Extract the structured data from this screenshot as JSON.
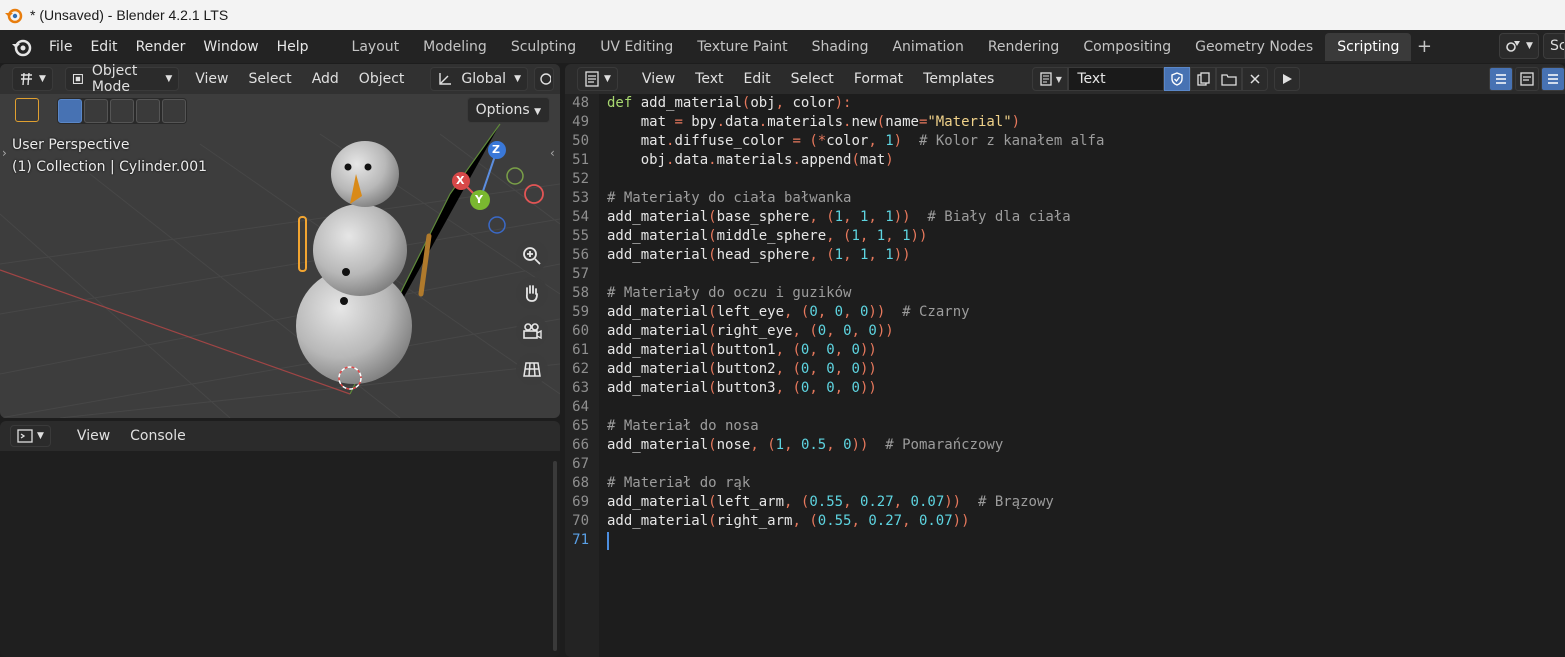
{
  "window": {
    "title": "* (Unsaved) - Blender 4.2.1 LTS"
  },
  "topbar": {
    "menus": [
      "File",
      "Edit",
      "Render",
      "Window",
      "Help"
    ],
    "workspaces": [
      "Layout",
      "Modeling",
      "Sculpting",
      "UV Editing",
      "Texture Paint",
      "Shading",
      "Animation",
      "Rendering",
      "Compositing",
      "Geometry Nodes",
      "Scripting"
    ],
    "active_workspace": "Scripting",
    "scene_label": "Sc"
  },
  "viewport": {
    "mode": "Object Mode",
    "menus": [
      "View",
      "Select",
      "Add",
      "Object"
    ],
    "transform": "Global",
    "options_label": "Options",
    "perspective": "User Perspective",
    "collection": "(1) Collection | Cylinder.001",
    "gizmo": {
      "z": "Z",
      "x": "X",
      "y": "Y"
    }
  },
  "console": {
    "menus": [
      "View",
      "Console"
    ]
  },
  "editor": {
    "menus": [
      "View",
      "Text",
      "Edit",
      "Select",
      "Format",
      "Templates"
    ],
    "text_name": "Text",
    "lines": [
      {
        "n": "48",
        "tokens": [
          [
            "kw",
            "def"
          ],
          [
            "p",
            " add_material"
          ],
          [
            "sym",
            "("
          ],
          [
            "p",
            "obj"
          ],
          [
            "sym",
            ","
          ],
          [
            "p",
            " color"
          ],
          [
            "sym",
            "):"
          ]
        ]
      },
      {
        "n": "49",
        "tokens": [
          [
            "p",
            "    mat "
          ],
          [
            "sym",
            "="
          ],
          [
            "p",
            " bpy"
          ],
          [
            "sym",
            "."
          ],
          [
            "p",
            "data"
          ],
          [
            "sym",
            "."
          ],
          [
            "p",
            "materials"
          ],
          [
            "sym",
            "."
          ],
          [
            "p",
            "new"
          ],
          [
            "sym",
            "("
          ],
          [
            "p",
            "name"
          ],
          [
            "sym",
            "="
          ],
          [
            "str",
            "\"Material\""
          ],
          [
            "sym",
            ")"
          ]
        ]
      },
      {
        "n": "50",
        "tokens": [
          [
            "p",
            "    mat"
          ],
          [
            "sym",
            "."
          ],
          [
            "p",
            "diffuse_color "
          ],
          [
            "sym",
            "="
          ],
          [
            "p",
            " "
          ],
          [
            "sym",
            "(*"
          ],
          [
            "p",
            "color"
          ],
          [
            "sym",
            ","
          ],
          [
            "p",
            " "
          ],
          [
            "num",
            "1"
          ],
          [
            "sym",
            ")"
          ],
          [
            "p",
            "  "
          ],
          [
            "cmt",
            "# Kolor z kanałem alfa"
          ]
        ]
      },
      {
        "n": "51",
        "tokens": [
          [
            "p",
            "    obj"
          ],
          [
            "sym",
            "."
          ],
          [
            "p",
            "data"
          ],
          [
            "sym",
            "."
          ],
          [
            "p",
            "materials"
          ],
          [
            "sym",
            "."
          ],
          [
            "p",
            "append"
          ],
          [
            "sym",
            "("
          ],
          [
            "p",
            "mat"
          ],
          [
            "sym",
            ")"
          ]
        ]
      },
      {
        "n": "52",
        "tokens": []
      },
      {
        "n": "53",
        "tokens": [
          [
            "cmt",
            "# Materiały do ciała bałwanka"
          ]
        ]
      },
      {
        "n": "54",
        "tokens": [
          [
            "p",
            "add_material"
          ],
          [
            "sym",
            "("
          ],
          [
            "p",
            "base_sphere"
          ],
          [
            "sym",
            ","
          ],
          [
            "p",
            " "
          ],
          [
            "sym",
            "("
          ],
          [
            "num",
            "1"
          ],
          [
            "sym",
            ","
          ],
          [
            "p",
            " "
          ],
          [
            "num",
            "1"
          ],
          [
            "sym",
            ","
          ],
          [
            "p",
            " "
          ],
          [
            "num",
            "1"
          ],
          [
            "sym",
            "))"
          ],
          [
            "p",
            "  "
          ],
          [
            "cmt",
            "# Biały dla ciała"
          ]
        ]
      },
      {
        "n": "55",
        "tokens": [
          [
            "p",
            "add_material"
          ],
          [
            "sym",
            "("
          ],
          [
            "p",
            "middle_sphere"
          ],
          [
            "sym",
            ","
          ],
          [
            "p",
            " "
          ],
          [
            "sym",
            "("
          ],
          [
            "num",
            "1"
          ],
          [
            "sym",
            ","
          ],
          [
            "p",
            " "
          ],
          [
            "num",
            "1"
          ],
          [
            "sym",
            ","
          ],
          [
            "p",
            " "
          ],
          [
            "num",
            "1"
          ],
          [
            "sym",
            "))"
          ]
        ]
      },
      {
        "n": "56",
        "tokens": [
          [
            "p",
            "add_material"
          ],
          [
            "sym",
            "("
          ],
          [
            "p",
            "head_sphere"
          ],
          [
            "sym",
            ","
          ],
          [
            "p",
            " "
          ],
          [
            "sym",
            "("
          ],
          [
            "num",
            "1"
          ],
          [
            "sym",
            ","
          ],
          [
            "p",
            " "
          ],
          [
            "num",
            "1"
          ],
          [
            "sym",
            ","
          ],
          [
            "p",
            " "
          ],
          [
            "num",
            "1"
          ],
          [
            "sym",
            "))"
          ]
        ]
      },
      {
        "n": "57",
        "tokens": []
      },
      {
        "n": "58",
        "tokens": [
          [
            "cmt",
            "# Materiały do oczu i guzików"
          ]
        ]
      },
      {
        "n": "59",
        "tokens": [
          [
            "p",
            "add_material"
          ],
          [
            "sym",
            "("
          ],
          [
            "p",
            "left_eye"
          ],
          [
            "sym",
            ","
          ],
          [
            "p",
            " "
          ],
          [
            "sym",
            "("
          ],
          [
            "num",
            "0"
          ],
          [
            "sym",
            ","
          ],
          [
            "p",
            " "
          ],
          [
            "num",
            "0"
          ],
          [
            "sym",
            ","
          ],
          [
            "p",
            " "
          ],
          [
            "num",
            "0"
          ],
          [
            "sym",
            "))"
          ],
          [
            "p",
            "  "
          ],
          [
            "cmt",
            "# Czarny"
          ]
        ]
      },
      {
        "n": "60",
        "tokens": [
          [
            "p",
            "add_material"
          ],
          [
            "sym",
            "("
          ],
          [
            "p",
            "right_eye"
          ],
          [
            "sym",
            ","
          ],
          [
            "p",
            " "
          ],
          [
            "sym",
            "("
          ],
          [
            "num",
            "0"
          ],
          [
            "sym",
            ","
          ],
          [
            "p",
            " "
          ],
          [
            "num",
            "0"
          ],
          [
            "sym",
            ","
          ],
          [
            "p",
            " "
          ],
          [
            "num",
            "0"
          ],
          [
            "sym",
            "))"
          ]
        ]
      },
      {
        "n": "61",
        "tokens": [
          [
            "p",
            "add_material"
          ],
          [
            "sym",
            "("
          ],
          [
            "p",
            "button1"
          ],
          [
            "sym",
            ","
          ],
          [
            "p",
            " "
          ],
          [
            "sym",
            "("
          ],
          [
            "num",
            "0"
          ],
          [
            "sym",
            ","
          ],
          [
            "p",
            " "
          ],
          [
            "num",
            "0"
          ],
          [
            "sym",
            ","
          ],
          [
            "p",
            " "
          ],
          [
            "num",
            "0"
          ],
          [
            "sym",
            "))"
          ]
        ]
      },
      {
        "n": "62",
        "tokens": [
          [
            "p",
            "add_material"
          ],
          [
            "sym",
            "("
          ],
          [
            "p",
            "button2"
          ],
          [
            "sym",
            ","
          ],
          [
            "p",
            " "
          ],
          [
            "sym",
            "("
          ],
          [
            "num",
            "0"
          ],
          [
            "sym",
            ","
          ],
          [
            "p",
            " "
          ],
          [
            "num",
            "0"
          ],
          [
            "sym",
            ","
          ],
          [
            "p",
            " "
          ],
          [
            "num",
            "0"
          ],
          [
            "sym",
            "))"
          ]
        ]
      },
      {
        "n": "63",
        "tokens": [
          [
            "p",
            "add_material"
          ],
          [
            "sym",
            "("
          ],
          [
            "p",
            "button3"
          ],
          [
            "sym",
            ","
          ],
          [
            "p",
            " "
          ],
          [
            "sym",
            "("
          ],
          [
            "num",
            "0"
          ],
          [
            "sym",
            ","
          ],
          [
            "p",
            " "
          ],
          [
            "num",
            "0"
          ],
          [
            "sym",
            ","
          ],
          [
            "p",
            " "
          ],
          [
            "num",
            "0"
          ],
          [
            "sym",
            "))"
          ]
        ]
      },
      {
        "n": "64",
        "tokens": []
      },
      {
        "n": "65",
        "tokens": [
          [
            "cmt",
            "# Materiał do nosa"
          ]
        ]
      },
      {
        "n": "66",
        "tokens": [
          [
            "p",
            "add_material"
          ],
          [
            "sym",
            "("
          ],
          [
            "p",
            "nose"
          ],
          [
            "sym",
            ","
          ],
          [
            "p",
            " "
          ],
          [
            "sym",
            "("
          ],
          [
            "num",
            "1"
          ],
          [
            "sym",
            ","
          ],
          [
            "p",
            " "
          ],
          [
            "num",
            "0.5"
          ],
          [
            "sym",
            ","
          ],
          [
            "p",
            " "
          ],
          [
            "num",
            "0"
          ],
          [
            "sym",
            "))"
          ],
          [
            "p",
            "  "
          ],
          [
            "cmt",
            "# Pomarańczowy"
          ]
        ]
      },
      {
        "n": "67",
        "tokens": []
      },
      {
        "n": "68",
        "tokens": [
          [
            "cmt",
            "# Materiał do rąk"
          ]
        ]
      },
      {
        "n": "69",
        "tokens": [
          [
            "p",
            "add_material"
          ],
          [
            "sym",
            "("
          ],
          [
            "p",
            "left_arm"
          ],
          [
            "sym",
            ","
          ],
          [
            "p",
            " "
          ],
          [
            "sym",
            "("
          ],
          [
            "num",
            "0.55"
          ],
          [
            "sym",
            ","
          ],
          [
            "p",
            " "
          ],
          [
            "num",
            "0.27"
          ],
          [
            "sym",
            ","
          ],
          [
            "p",
            " "
          ],
          [
            "num",
            "0.07"
          ],
          [
            "sym",
            "))"
          ],
          [
            "p",
            "  "
          ],
          [
            "cmt",
            "# Brązowy"
          ]
        ]
      },
      {
        "n": "70",
        "tokens": [
          [
            "p",
            "add_material"
          ],
          [
            "sym",
            "("
          ],
          [
            "p",
            "right_arm"
          ],
          [
            "sym",
            ","
          ],
          [
            "p",
            " "
          ],
          [
            "sym",
            "("
          ],
          [
            "num",
            "0.55"
          ],
          [
            "sym",
            ","
          ],
          [
            "p",
            " "
          ],
          [
            "num",
            "0.27"
          ],
          [
            "sym",
            ","
          ],
          [
            "p",
            " "
          ],
          [
            "num",
            "0.07"
          ],
          [
            "sym",
            "))"
          ]
        ]
      },
      {
        "n": "71",
        "tokens": []
      }
    ],
    "current_line": "71"
  },
  "colors": {
    "accent": "#4772b3",
    "keyword": "#a8d870",
    "string": "#f0d28a",
    "number": "#5ed4e0",
    "symbol": "#e8795d",
    "comment": "#9c9c9c"
  }
}
